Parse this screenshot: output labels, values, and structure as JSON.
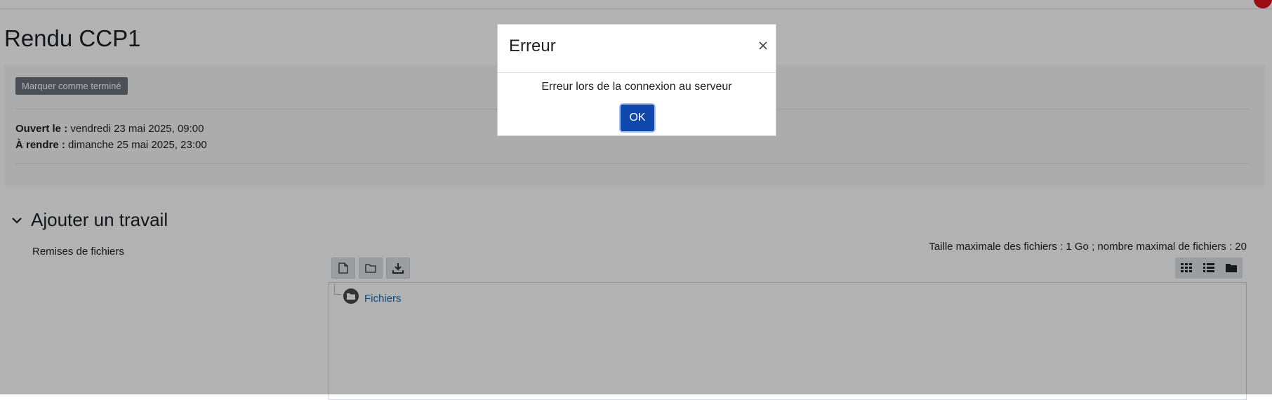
{
  "page": {
    "title": "Rendu CCP1",
    "complete_button": "Marquer comme terminé",
    "dates": {
      "opened_label": "Ouvert le :",
      "opened_value": "vendredi 23 mai 2025, 09:00",
      "due_label": "À rendre :",
      "due_value": "dimanche 25 mai 2025, 23:00"
    }
  },
  "submission": {
    "section_title": "Ajouter un travail",
    "field_label": "Remises de fichiers",
    "limits": "Taille maximale des fichiers : 1 Go ; nombre maximal de fichiers : 20",
    "folder_name": "Fichiers",
    "toolbar_icons": [
      "add-file-icon",
      "create-folder-icon",
      "download-icon"
    ],
    "view_icons": [
      "grid-view-icon",
      "list-view-icon",
      "folder-view-icon"
    ]
  },
  "modal": {
    "title": "Erreur",
    "message": "Erreur lors de la connexion au serveur",
    "ok_label": "OK",
    "close_icon": "close-icon"
  },
  "colors": {
    "primary": "#0f47ad",
    "link": "#0f6cbf",
    "notification": "#e0141c"
  }
}
